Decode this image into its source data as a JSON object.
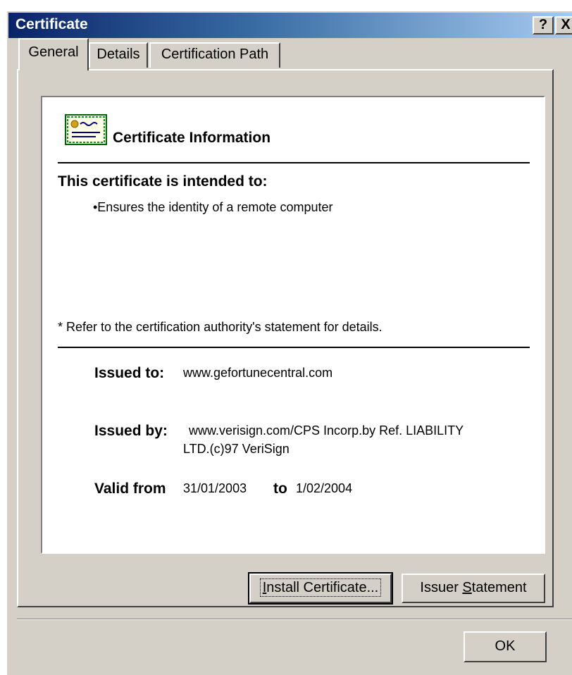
{
  "window": {
    "title": "Certificate",
    "help_label": "?",
    "close_label": "X"
  },
  "tabs": [
    {
      "label": "General",
      "active": true
    },
    {
      "label": "Details",
      "active": false
    },
    {
      "label": "Certification Path",
      "active": false
    }
  ],
  "info": {
    "title": "Certificate Information",
    "icon": "certificate-icon",
    "intended_heading": "This certificate is intended to:",
    "purposes": [
      "•Ensures the identity of a remote computer"
    ],
    "refer_note": "* Refer to the certification authority's statement for details.",
    "issued_to_label": "Issued to:",
    "issued_to_value": "www.gefortunecentral.com",
    "issued_by_label": "Issued by:",
    "issued_by_line1": "www.verisign.com/CPS Incorp.by Ref. LIABILITY",
    "issued_by_line2": "LTD.(c)97 VeriSign",
    "valid_from_label": "Valid from",
    "valid_from_value": "31/01/2003",
    "valid_to_label": "to",
    "valid_to_value": "1/02/2004"
  },
  "buttons": {
    "install": {
      "accel": "I",
      "rest": "nstall Certificate..."
    },
    "issuer": {
      "before": "Issuer ",
      "accel": "S",
      "rest": "tatement"
    },
    "ok": "OK"
  }
}
